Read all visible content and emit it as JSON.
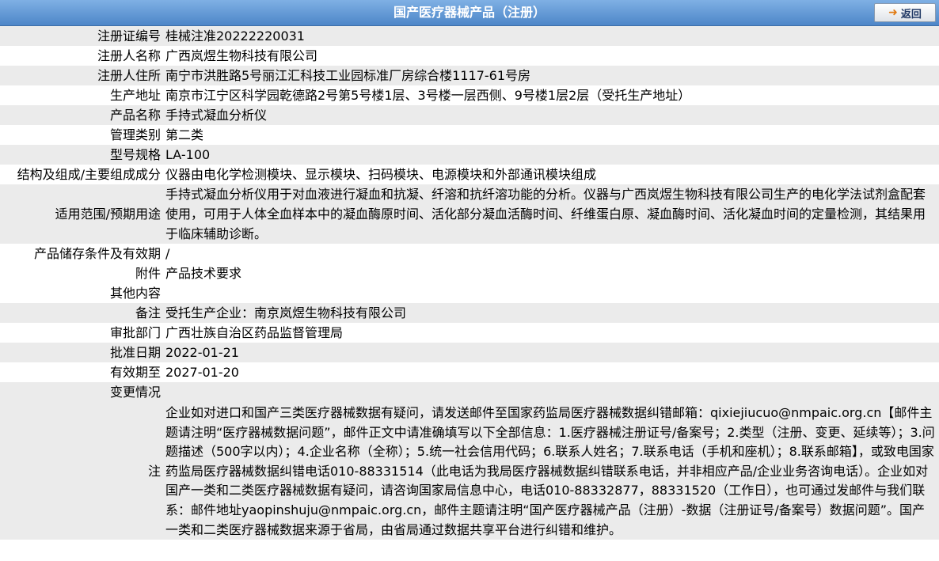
{
  "header": {
    "title": "国产医疗器械产品（注册）",
    "back_label": "返回"
  },
  "rows": [
    {
      "label": "注册证编号",
      "value": "桂械注准20222220031"
    },
    {
      "label": "注册人名称",
      "value": "广西岚煜生物科技有限公司"
    },
    {
      "label": "注册人住所",
      "value": "南宁市洪胜路5号丽江汇科技工业园标准厂房综合楼1117-61号房"
    },
    {
      "label": "生产地址",
      "value": "南京市江宁区科学园乾德路2号第5号楼1层、3号楼一层西侧、9号楼1层2层（受托生产地址）"
    },
    {
      "label": "产品名称",
      "value": "手持式凝血分析仪"
    },
    {
      "label": "管理类别",
      "value": "第二类"
    },
    {
      "label": "型号规格",
      "value": "LA-100"
    },
    {
      "label": "结构及组成/主要组成成分",
      "value": "仪器由电化学检测模块、显示模块、扫码模块、电源模块和外部通讯模块组成"
    },
    {
      "label": "适用范围/预期用途",
      "value": "手持式凝血分析仪用于对血液进行凝血和抗凝、纤溶和抗纤溶功能的分析。仪器与广西岚煜生物科技有限公司生产的电化学法试剂盒配套使用，可用于人体全血样本中的凝血酶原时间、活化部分凝血活酶时间、纤维蛋白原、凝血酶时间、活化凝血时间的定量检测，其结果用于临床辅助诊断。"
    },
    {
      "label": "产品储存条件及有效期",
      "value": "/"
    },
    {
      "label": "附件",
      "value": "产品技术要求"
    },
    {
      "label": "其他内容",
      "value": ""
    },
    {
      "label": "备注",
      "value": "受托生产企业：南京岚煜生物科技有限公司"
    },
    {
      "label": "审批部门",
      "value": "广西壮族自治区药品监督管理局"
    },
    {
      "label": "批准日期",
      "value": "2022-01-21"
    },
    {
      "label": "有效期至",
      "value": "2027-01-20"
    },
    {
      "label": "变更情况",
      "value": ""
    },
    {
      "label": "注",
      "value": "企业如对进口和国产三类医疗器械数据有疑问，请发送邮件至国家药监局医疗器械数据纠错邮箱：qixiejiucuo@nmpaic.org.cn【邮件主题请注明“医疗器械数据问题”，邮件正文中请准确填写以下全部信息：1.医疗器械注册证号/备案号；2.类型（注册、变更、延续等）；3.问题描述（500字以内）；4.企业名称（全称）；5.统一社会信用代码；6.联系人姓名；7.联系电话（手机和座机）；8.联系邮箱】，或致电国家药监局医疗器械数据纠错电话010-88331514（此电话为我局医疗器械数据纠错联系电话，并非相应产品/企业业务咨询电话）。企业如对国产一类和二类医疗器械数据有疑问，请咨询国家局信息中心，电话010-88332877，88331520（工作日），也可通过发邮件与我们联系：邮件地址yaopinshuju@nmpaic.org.cn，邮件主题请注明“国产医疗器械产品（注册）-数据（注册证号/备案号）数据问题”。国产一类和二类医疗器械数据来源于省局，由省局通过数据共享平台进行纠错和维护。"
    }
  ]
}
